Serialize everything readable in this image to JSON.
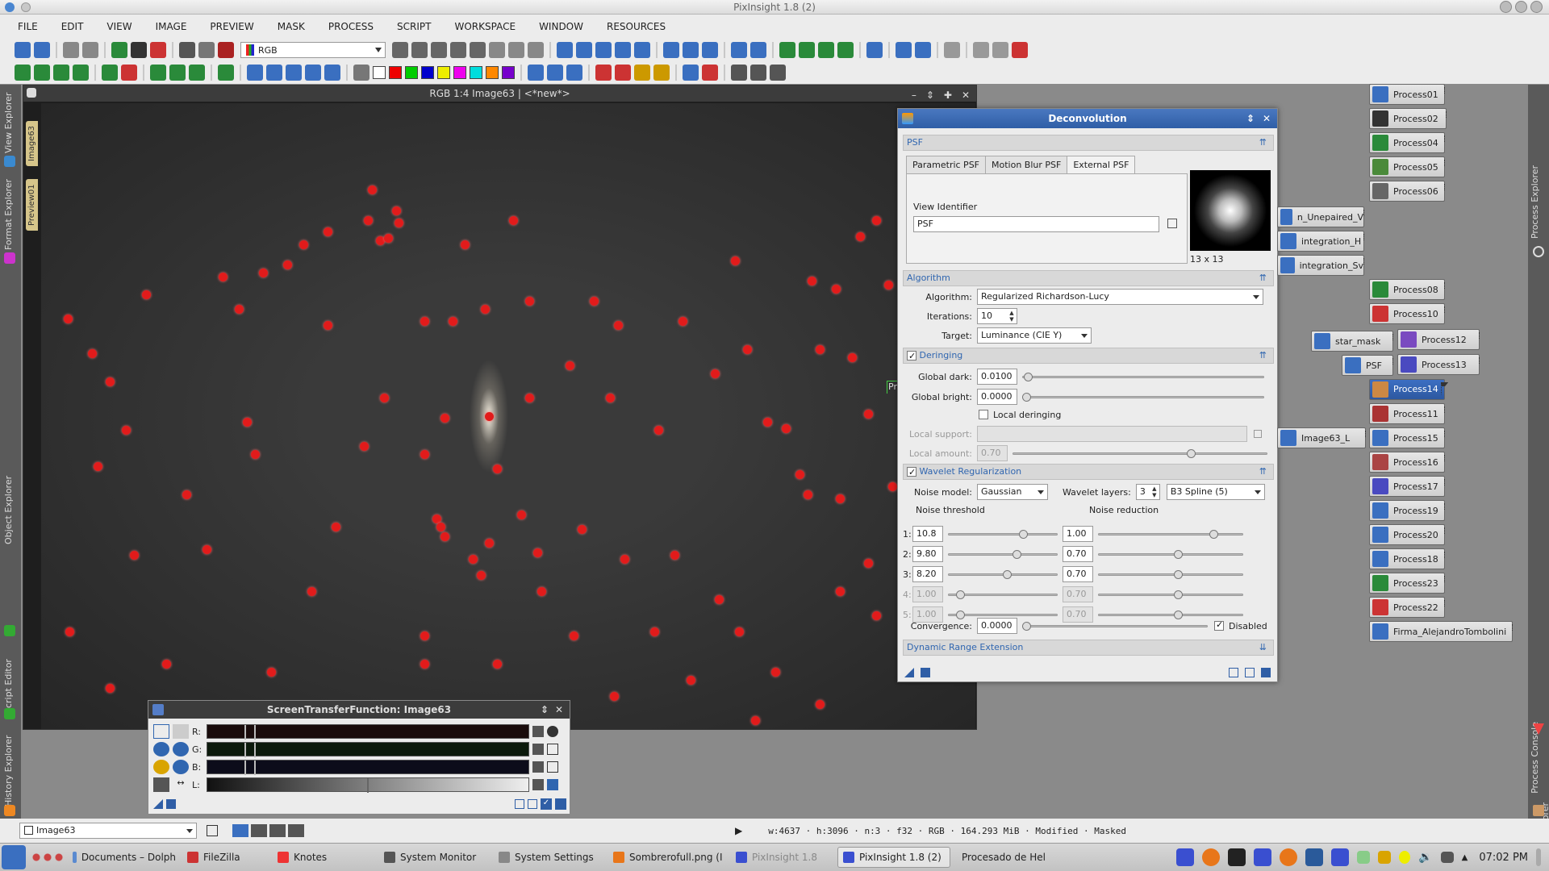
{
  "window": {
    "title": "PixInsight 1.8 (2)"
  },
  "menu": [
    "FILE",
    "EDIT",
    "VIEW",
    "IMAGE",
    "PREVIEW",
    "MASK",
    "PROCESS",
    "SCRIPT",
    "WORKSPACE",
    "WINDOW",
    "RESOURCES"
  ],
  "toolbar": {
    "channel_select": "RGB"
  },
  "left_tabs": [
    "View Explorer",
    "Format Explorer",
    "Object Explorer",
    "Script Editor",
    "History Explorer"
  ],
  "right_tabs": [
    "Process Explorer",
    "Process Console",
    "File Explorer"
  ],
  "image_window": {
    "title": "RGB 1:4 Image63 | <*new*>",
    "tab": "Image63",
    "preview_tab": "Preview01",
    "preview_label": "Preview01"
  },
  "deconvolution": {
    "title": "Deconvolution",
    "psf_section": "PSF",
    "tabs": [
      "Parametric PSF",
      "Motion Blur PSF",
      "External PSF"
    ],
    "view_identifier_label": "View Identifier",
    "view_identifier": "PSF",
    "psf_size": "13 x 13",
    "algorithm_section": "Algorithm",
    "algorithm_label": "Algorithm:",
    "algorithm": "Regularized Richardson-Lucy",
    "iterations_label": "Iterations:",
    "iterations": "10",
    "target_label": "Target:",
    "target": "Luminance (CIE Y)",
    "deringing_section": "Deringing",
    "global_dark_label": "Global dark:",
    "global_dark": "0.0100",
    "global_bright_label": "Global bright:",
    "global_bright": "0.0000",
    "local_deringing_label": "Local deringing",
    "local_support_label": "Local support:",
    "local_amount_label": "Local amount:",
    "local_amount": "0.70",
    "wavelet_section": "Wavelet Regularization",
    "noise_model_label": "Noise model:",
    "noise_model": "Gaussian",
    "wavelet_layers_label": "Wavelet layers:",
    "wavelet_layers": "3",
    "wavelet_scaling": "B3 Spline (5)",
    "noise_threshold_label": "Noise threshold",
    "noise_reduction_label": "Noise reduction",
    "layers": [
      {
        "n": "1:",
        "threshold": "10.8",
        "reduction": "1.00",
        "enabled": true
      },
      {
        "n": "2:",
        "threshold": "9.80",
        "reduction": "0.70",
        "enabled": true
      },
      {
        "n": "3:",
        "threshold": "8.20",
        "reduction": "0.70",
        "enabled": true
      },
      {
        "n": "4:",
        "threshold": "1.00",
        "reduction": "0.70",
        "enabled": false
      },
      {
        "n": "5:",
        "threshold": "1.00",
        "reduction": "0.70",
        "enabled": false
      }
    ],
    "convergence_label": "Convergence:",
    "convergence": "0.0000",
    "disabled_label": "Disabled",
    "dynamic_range_section": "Dynamic Range Extension"
  },
  "processes": [
    "Process01",
    "Process02",
    "Process04",
    "Process05",
    "Process06",
    "n_Unepaired_V",
    "integration_H",
    "integration_Sv",
    "Process08",
    "Process10",
    "star_mask",
    "Process12",
    "PSF",
    "Process13",
    "Process14",
    "Process11",
    "Process15",
    "Process16",
    "Image63_L",
    "Process17",
    "Process19",
    "Process20",
    "Process18",
    "Process23",
    "Process22",
    "Firma_AlejandroTombolini"
  ],
  "stf": {
    "title": "ScreenTransferFunction: Image63",
    "channels": [
      "R:",
      "G:",
      "B:",
      "L:"
    ]
  },
  "statusbar": {
    "view": "Image63",
    "info": "w:4637 · h:3096 · n:3 · f32 · RGB · 164.293 MiB · Modified · Masked"
  },
  "taskbar": {
    "tasks": [
      "Documents – Dolph",
      "FileZilla",
      "Knotes",
      "System Monitor",
      "System Settings",
      "Sombrerofull.png (I",
      "PixInsight 1.8",
      "PixInsight 1.8 (2)",
      "Procesado de Hel"
    ],
    "clock": "07:02 PM"
  }
}
